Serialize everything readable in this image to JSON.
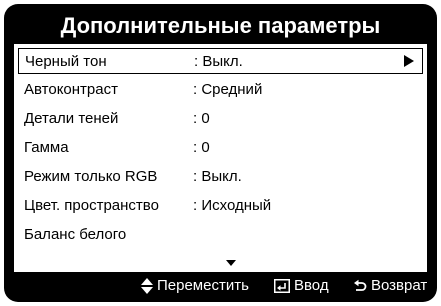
{
  "menu": {
    "title": "Дополнительные параметры",
    "items": [
      {
        "label": "Черный тон",
        "value": ": Выкл.",
        "selected": true
      },
      {
        "label": "Автоконтраст",
        "value": ": Средний",
        "selected": false
      },
      {
        "label": "Детали теней",
        "value": ": 0",
        "selected": false
      },
      {
        "label": "Гамма",
        "value": ": 0",
        "selected": false
      },
      {
        "label": "Режим только RGB",
        "value": ": Выкл.",
        "selected": false
      },
      {
        "label": "Цвет. пространство",
        "value": ": Исходный",
        "selected": false
      },
      {
        "label": "Баланс белого",
        "value": "",
        "selected": false
      }
    ],
    "icons": {
      "selected_arrow": "triangle-right-icon",
      "more_below": "triangle-down-icon"
    }
  },
  "footer": {
    "move_label": "Переместить",
    "enter_label": "Ввод",
    "return_label": "Возврат",
    "icons": {
      "move": "up-down-arrows-icon",
      "enter": "enter-icon",
      "return": "return-icon"
    }
  },
  "colors": {
    "frame": "#000000",
    "panel": "#ffffff",
    "text": "#000000",
    "footer_text": "#ffffff"
  }
}
